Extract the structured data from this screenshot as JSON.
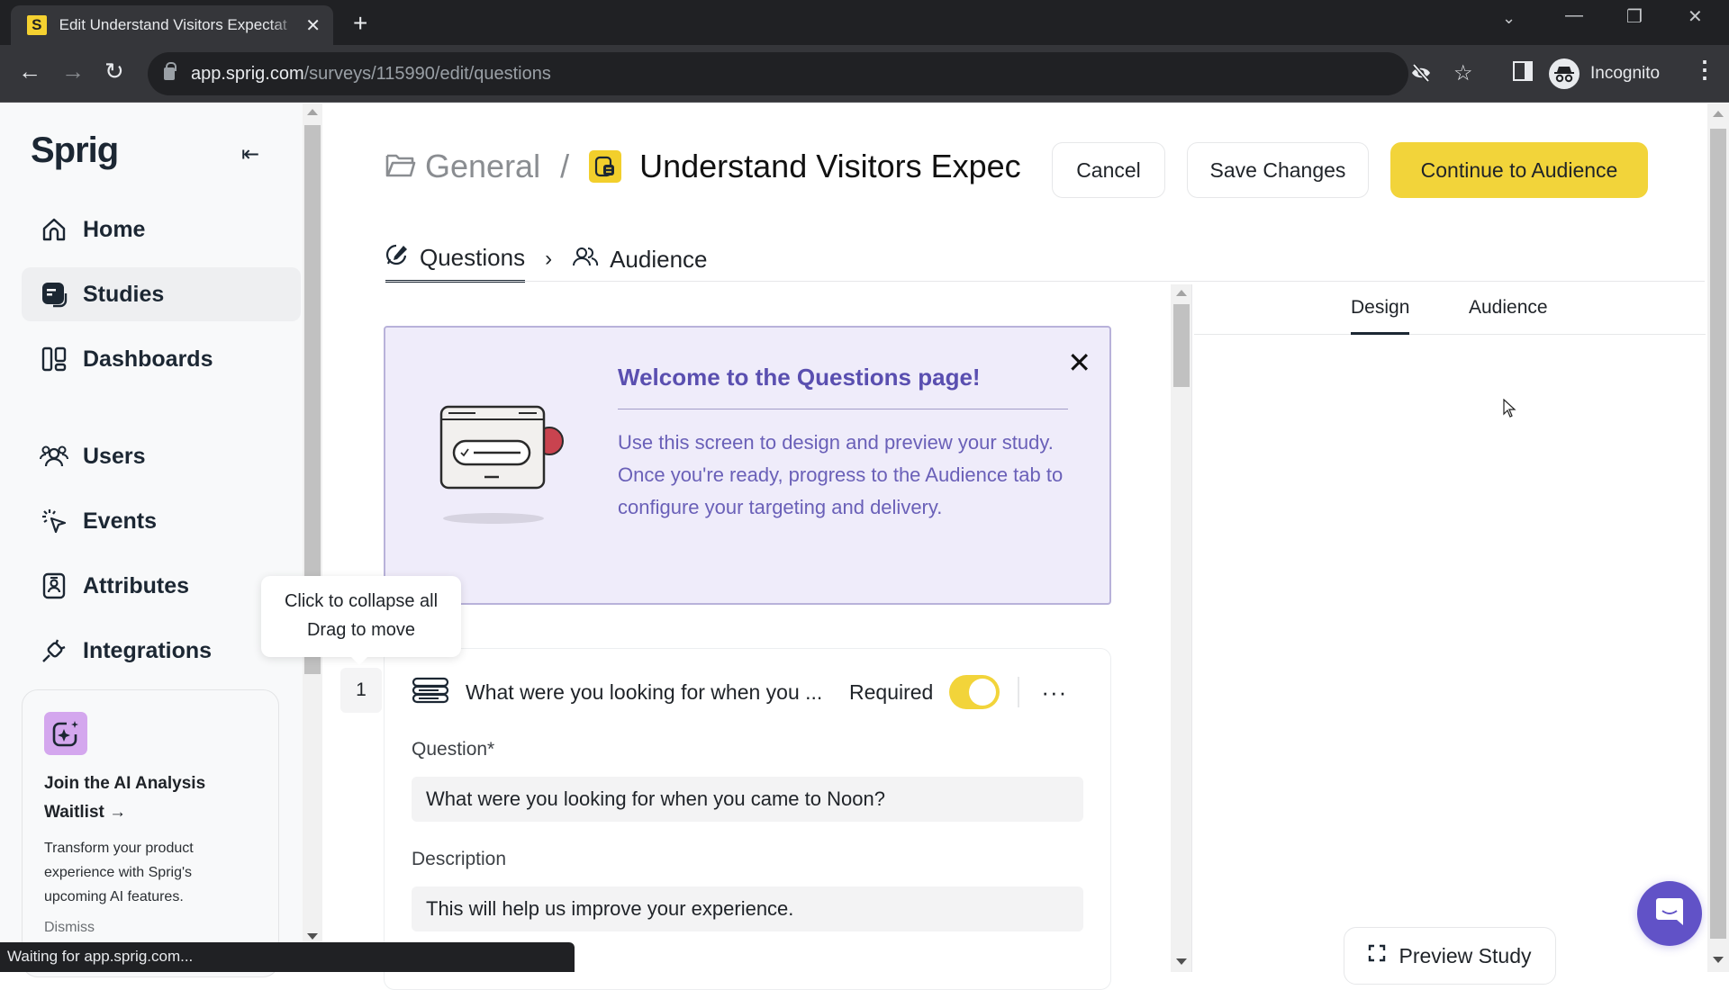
{
  "browser": {
    "tab_title": "Edit Understand Visitors Expectat",
    "tab_favicon_letter": "S",
    "url_host": "app.sprig.com",
    "url_path": "/surveys/115990/edit/questions",
    "profile_label": "Incognito",
    "status_text": "Waiting for app.sprig.com..."
  },
  "sidebar": {
    "logo": "Sprig",
    "items": [
      {
        "label": "Home",
        "icon": "home-icon",
        "active": false
      },
      {
        "label": "Studies",
        "icon": "studies-icon",
        "active": true
      },
      {
        "label": "Dashboards",
        "icon": "dashboards-icon",
        "active": false
      },
      {
        "label": "Users",
        "icon": "users-icon",
        "active": false
      },
      {
        "label": "Events",
        "icon": "events-icon",
        "active": false
      },
      {
        "label": "Attributes",
        "icon": "attributes-icon",
        "active": false
      },
      {
        "label": "Integrations",
        "icon": "integrations-icon",
        "active": false
      }
    ],
    "promo": {
      "title": "Join the AI Analysis Waitlist →",
      "description": "Transform your product experience with Sprig's upcoming AI features.",
      "dismiss_label": "Dismiss"
    }
  },
  "header": {
    "folder": "General",
    "separator": "/",
    "study_title": "Understand Visitors Expec",
    "cancel_label": "Cancel",
    "save_label": "Save Changes",
    "continue_label": "Continue to Audience",
    "steps": [
      {
        "label": "Questions",
        "active": true
      },
      {
        "label": "Audience",
        "active": false
      }
    ],
    "step_separator": "›"
  },
  "banner": {
    "title": "Welcome to the Questions page!",
    "text": "Use this screen to design and preview your study. Once you're ready, progress to the Audience tab to configure your targeting and delivery."
  },
  "tooltip": {
    "line1": "Click to collapse all",
    "line2": "Drag to move"
  },
  "question": {
    "number": "1",
    "summary": "What were you looking for when you ...",
    "required_label": "Required",
    "required": true,
    "more_label": "···",
    "question_label": "Question*",
    "question_value": "What were you looking for when you came to Noon?",
    "description_label": "Description",
    "description_value": "This will help us improve your experience."
  },
  "right_panel": {
    "tabs": [
      {
        "label": "Design",
        "active": true
      },
      {
        "label": "Audience",
        "active": false
      }
    ],
    "preview_label": "Preview Study"
  },
  "colors": {
    "brand_yellow": "#f2d43a",
    "banner_bg": "#efecfa",
    "banner_text": "#5a4fb0",
    "chat_purple": "#6152c7",
    "ai_icon_bg": "#d4a7ee"
  }
}
